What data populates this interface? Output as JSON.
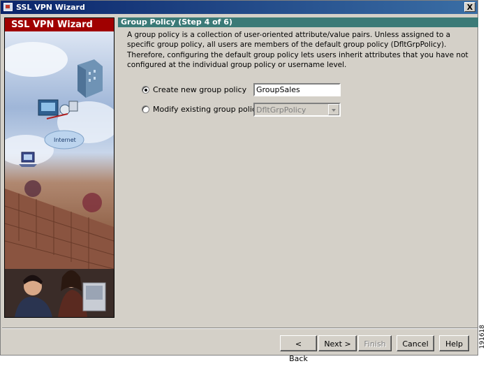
{
  "window": {
    "title": "SSL VPN Wizard",
    "close_glyph": "X"
  },
  "sidebar": {
    "header": "SSL VPN Wizard",
    "art_label": "Internet"
  },
  "panel": {
    "title": "Group Policy   (Step 4 of 6)",
    "description": "A group policy is a collection of user-oriented attribute/value pairs. Unless assigned to a specific group policy, all users are members of the default group policy (DfltGrpPolicy). Therefore, configuring the default group policy lets users inherit attributes that you have not configured at the individual group policy or username level."
  },
  "options": {
    "create_new_label": "Create new group policy",
    "create_new_value": "GroupSales",
    "create_new_selected": true,
    "modify_existing_label": "Modify existing group policy",
    "modify_existing_value": "DfltGrpPolicy",
    "modify_existing_selected": false
  },
  "buttons": {
    "back": "< Back",
    "next": "Next >",
    "finish": "Finish",
    "cancel": "Cancel",
    "help": "Help"
  },
  "figure_id": "191618",
  "icons": {
    "app": "ssl-vpn-app-icon",
    "close": "close-icon",
    "dropdown": "chevron-down-icon"
  }
}
